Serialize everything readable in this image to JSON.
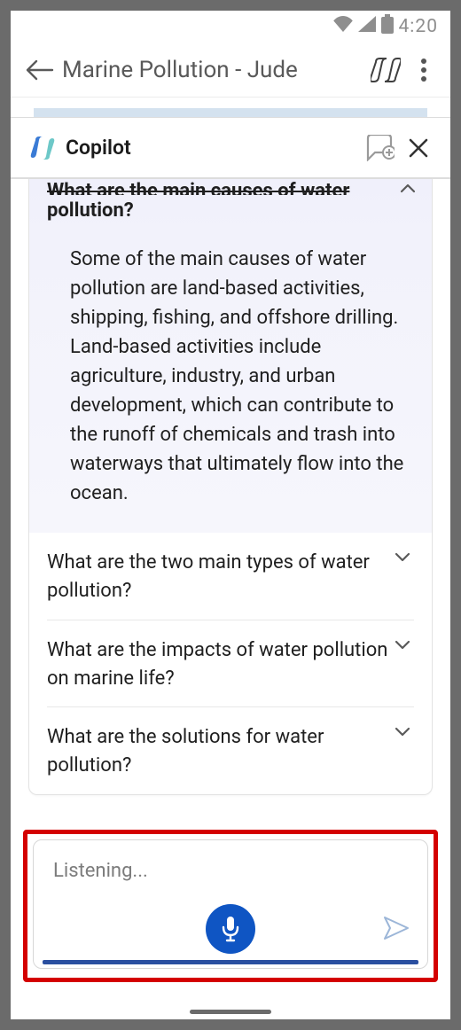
{
  "status": {
    "time": "4:20"
  },
  "app_bar": {
    "title": "Marine Pollution - Jude"
  },
  "copilot_header": {
    "name": "Copilot"
  },
  "accordion": {
    "items": [
      {
        "question": "What are the main causes of water pollution?",
        "expanded": true,
        "answer": "Some of the main causes of water pollution are land-based activities, shipping, fishing, and offshore drilling. Land-based activities include agriculture, industry, and urban development, which can contribute to the runoff of chemicals and trash into waterways that ultimately flow into the ocean."
      },
      {
        "question": "What are the two main types of water pollution?",
        "expanded": false
      },
      {
        "question": "What are the impacts of water pollution on marine life?",
        "expanded": false
      },
      {
        "question": "What are the solutions for water pollution?",
        "expanded": false
      }
    ]
  },
  "input": {
    "placeholder": "Listening..."
  },
  "icons": {
    "wifi": "wifi-icon",
    "signal": "signal-icon",
    "battery": "battery-icon",
    "back": "back-arrow-icon",
    "copilot_small": "copilot-glyph-icon",
    "more": "more-vertical-icon",
    "chat_plus": "chat-plus-icon",
    "close": "close-icon",
    "chev_up": "chevron-up-icon",
    "chev_down": "chevron-down-icon",
    "mic": "microphone-icon",
    "send": "send-icon",
    "copilot_logo": "copilot-logo-icon"
  }
}
